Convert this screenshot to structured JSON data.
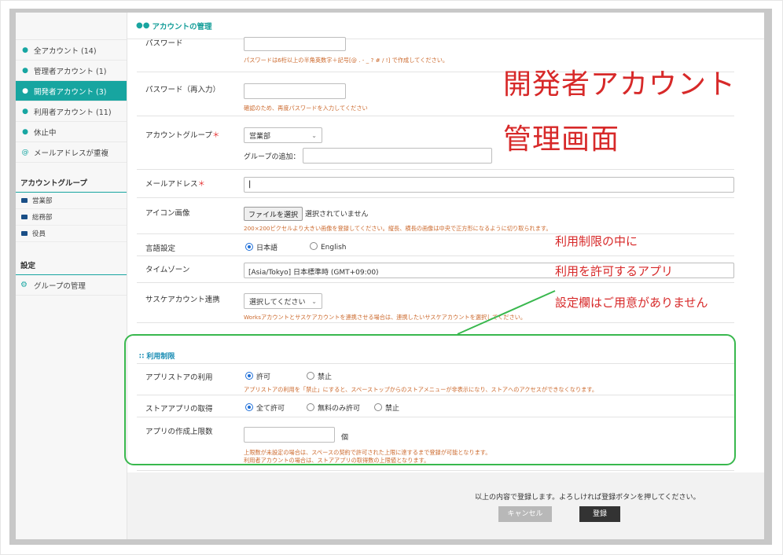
{
  "header": {
    "title": "アカウントの管理"
  },
  "sidebar": {
    "items": [
      {
        "label": "全アカウント (14)",
        "icon": "people-icon"
      },
      {
        "label": "管理者アカウント (1)",
        "icon": "admin-icon"
      },
      {
        "label": "開発者アカウント (3)",
        "icon": "developer-icon"
      },
      {
        "label": "利用者アカウント (11)",
        "icon": "user-icon"
      },
      {
        "label": "休止中",
        "icon": "paused-user-icon"
      },
      {
        "label": "メールアドレスが重複",
        "icon": "at-icon"
      }
    ],
    "group_heading": "アカウントグループ",
    "groups": [
      "営業部",
      "総務部",
      "役員"
    ],
    "settings_heading": "設定",
    "settings_item": "グループの管理"
  },
  "form": {
    "password_label": "パスワード",
    "password_note": "パスワードは6桁以上の半角英数字＋記号[@ . - _ ? # / !] で作成してください。",
    "password2_label": "パスワード（再入力）",
    "password2_note": "確認のため、再度パスワードを入力してください",
    "group_label": "アカウントグループ",
    "required_mark": "＊",
    "group_value": "営業部",
    "group_add_label": "グループの追加：",
    "email_label": "メールアドレス",
    "icon_label": "アイコン画像",
    "file_button": "ファイルを選択",
    "file_status": "選択されていません",
    "icon_note": "200×200ピクセルより大きい画像を登録してください。縦長、横長の画像は中央で正方形になるように切り取られます。",
    "lang_label": "言語設定",
    "lang_ja": "日本語",
    "lang_en": "English",
    "tz_label": "タイムゾーン",
    "tz_value": "[Asia/Tokyo] 日本標準時 (GMT+09:00)",
    "link_label": "サスケアカウント連携",
    "link_value": "選択してください",
    "link_note": "Worksアカウントとサスケアカウントを連携させる場合は、連携したいサスケアカウントを選択してください。"
  },
  "restriction": {
    "title": "利用制限",
    "appstore_label": "アプリストアの利用",
    "allow": "許可",
    "deny": "禁止",
    "appstore_note": "アプリストアの利用を「禁止」にすると、スペーストップからのストアメニューが非表示になり、ストアへのアクセスができなくなります。",
    "acquire_label": "ストアアプリの取得",
    "all_allow": "全て許可",
    "free_only": "無料のみ許可",
    "deny2": "禁止",
    "limit_label": "アプリの作成上限数",
    "unit": "個",
    "limit_note1": "上限数が未設定の場合は、スペースの契約で許可された上限に達するまで登録が可能となります。",
    "limit_note2": "利用者アカウントの場合は、ストアアプリの取得数の上限値となります。"
  },
  "footer": {
    "confirm_text": "以上の内容で登録します。よろしければ登録ボタンを押してください。",
    "cancel": "キャンセル",
    "register": "登録"
  },
  "annotations": {
    "title1": "開発者アカウント",
    "title2": "管理画面",
    "note1": "利用制限の中に",
    "note2": "利用を許可するアプリ",
    "note3": "設定欄はご用意がありません"
  },
  "colors": {
    "accent": "#17a5a0",
    "annotation_red": "#d72929",
    "highlight_green": "#39b84e"
  }
}
